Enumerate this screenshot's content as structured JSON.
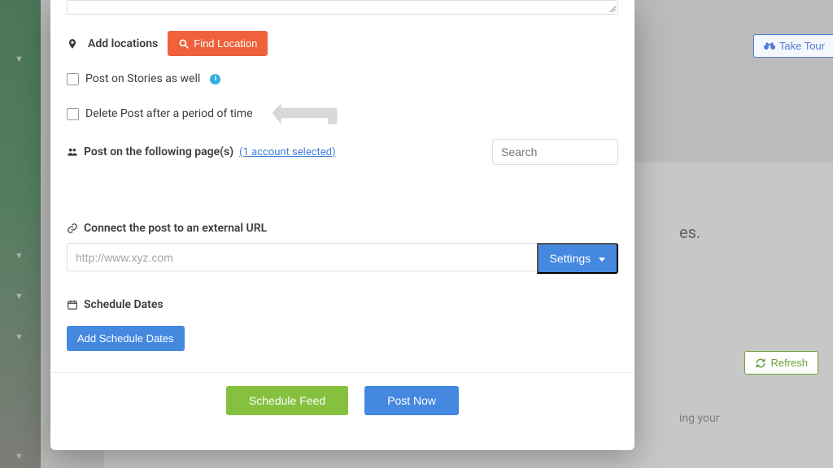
{
  "topbar": {
    "take_tour": "Take Tour",
    "refresh": "Refresh"
  },
  "bg": {
    "snippet1": "es.",
    "snippet2": "ing your"
  },
  "modal": {
    "locations": {
      "label": "Add locations",
      "find_button": "Find Location"
    },
    "stories_checkbox": "Post on Stories as well",
    "delete_checkbox": "Delete Post after a period of time",
    "pages": {
      "label": "Post on the following page(s)",
      "selected_text": "(1 account selected)",
      "search_placeholder": "Search"
    },
    "connect": {
      "label": "Connect the post to an external URL",
      "placeholder": "http://www.xyz.com",
      "settings_button": "Settings"
    },
    "schedule": {
      "label": "Schedule Dates",
      "add_button": "Add Schedule Dates"
    },
    "footer": {
      "schedule_feed": "Schedule Feed",
      "post_now": "Post Now"
    }
  }
}
